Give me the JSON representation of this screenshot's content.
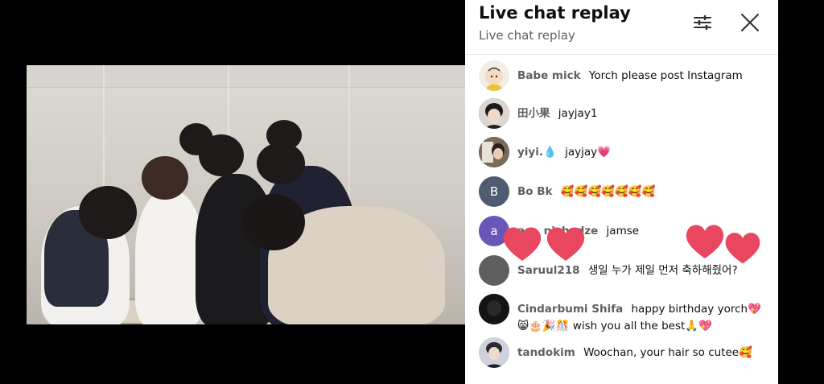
{
  "chat": {
    "title": "Live chat replay",
    "subtitle": "Live chat replay",
    "messages": [
      {
        "author": "Babe mick",
        "text": "Yorch please post Instagram"
      },
      {
        "author": "田小果",
        "text": "jayjay1"
      },
      {
        "author": "yiyi.💧",
        "text": "jayjay💗"
      },
      {
        "author": "Bo Bk",
        "text": "🥰🥰🥰🥰🥰🥰🥰",
        "avatar_letter": "B"
      },
      {
        "author": "a     nichadze",
        "text": "jamse",
        "avatar_letter": "a"
      },
      {
        "author": "Saruul218",
        "text": "생일 누가 제일 먼저 축하해줬어?"
      },
      {
        "author": "Cindarbumi Shifa",
        "text": "happy birthday yorch💖",
        "text_line2": "😸🎂🎉🎊 wish you all the best🙏💖"
      },
      {
        "author": "tandokim",
        "text": "Woochan, your hair so cutee🥰"
      }
    ]
  },
  "colors": {
    "avatar_b": "#4f5b70",
    "avatar_a": "#6a56b8",
    "heart": "#e8475f"
  }
}
